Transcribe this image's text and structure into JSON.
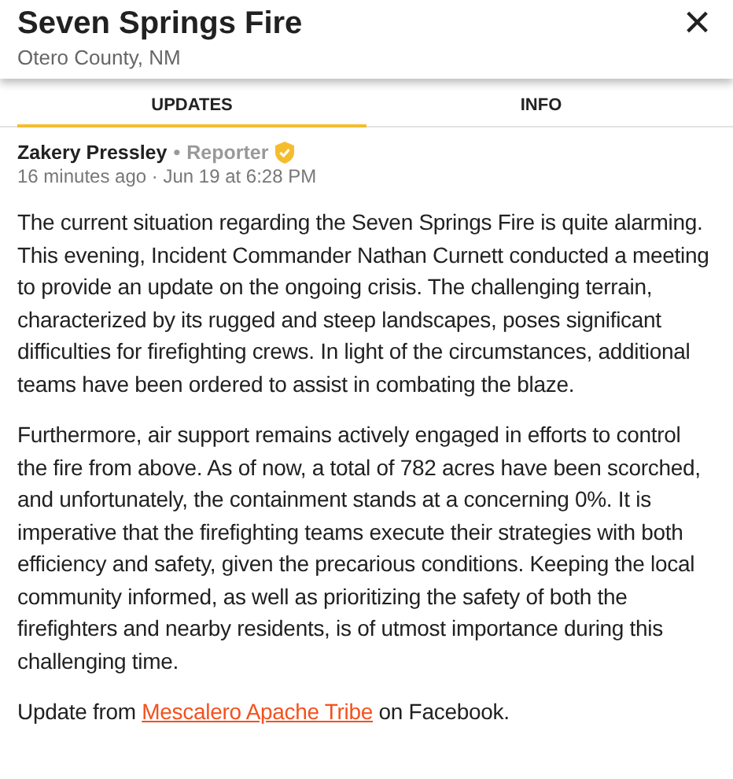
{
  "header": {
    "title": "Seven Springs Fire",
    "subtitle": "Otero County, NM",
    "close": "×"
  },
  "tabs": [
    {
      "label": "UPDATES",
      "selected": true
    },
    {
      "label": "INFO",
      "selected": false
    }
  ],
  "post": {
    "author": "Zakery Pressley",
    "role": "Reporter",
    "separator": "•",
    "time": "16 minutes ago · Jun 19 at 6:28 PM",
    "paragraphs": [
      "The current situation regarding the Seven Springs Fire is quite alarming. This evening, Incident Commander Nathan Curnett conducted a meeting to provide an update on the ongoing crisis. The challenging terrain, characterized by its rugged and steep landscapes, poses significant difficulties for firefighting crews. In light of the circumstances, additional teams have been ordered to assist in combating the blaze.",
      "Furthermore, air support remains actively engaged in efforts to control the fire from above. As of now, a total of 782 acres have been scorched, and unfortunately, the containment stands at a concerning 0%. It is imperative that the firefighting teams execute their strategies with both efficiency and safety, given the precarious conditions. Keeping the local community informed, as well as prioritizing the safety of both the firefighters and nearby residents, is of utmost importance during this challenging time."
    ],
    "source": {
      "prefix": "Update from",
      "link": "Mescalero Apache Tribe",
      "suffix": "on Facebook."
    }
  }
}
